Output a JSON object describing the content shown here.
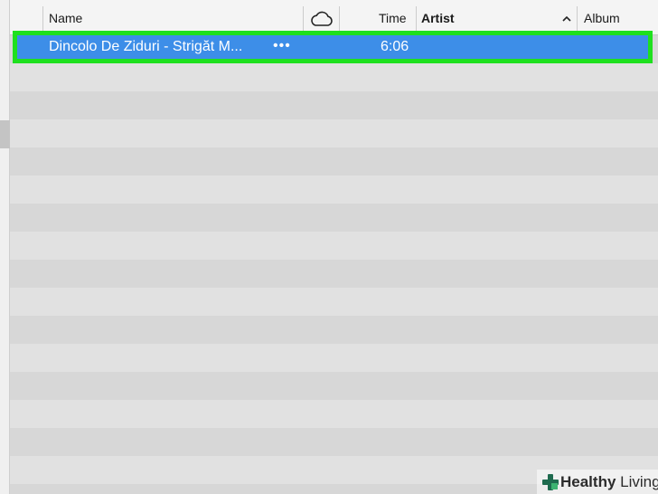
{
  "header": {
    "name_label": "Name",
    "time_label": "Time",
    "artist_label": "Artist",
    "album_label": "Album",
    "cloud_icon": "cloud-icon",
    "sort_icon": "chevron-up-icon"
  },
  "track": {
    "name": "Dincolo De Ziduri - Strigăt M...",
    "more": "•••",
    "time": "6:06"
  },
  "watermark": {
    "bold": "Healthy",
    "rest": " Living"
  },
  "colors": {
    "selection": "#3d8ee8",
    "highlight_border": "#1ee01e"
  }
}
